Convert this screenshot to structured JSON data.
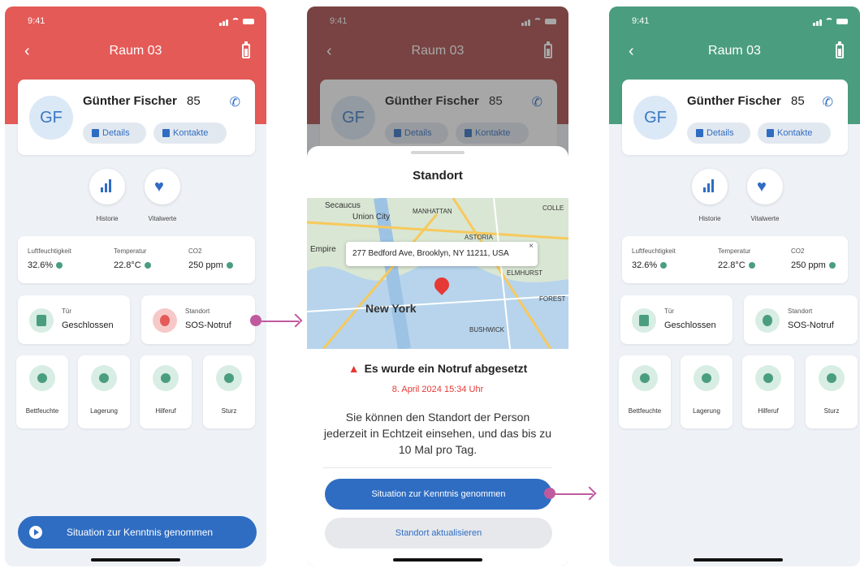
{
  "status": {
    "time": "9:41"
  },
  "header": {
    "title": "Raum 03",
    "back_icon": "chevron-left-icon",
    "battery_icon": "battery-icon"
  },
  "patient": {
    "initials": "GF",
    "name": "Günther Fischer",
    "age": "85",
    "details_label": "Details",
    "contacts_label": "Kontakte"
  },
  "round_buttons": [
    {
      "label": "Historie",
      "icon": "bar-chart-icon"
    },
    {
      "label": "Vitalwerte",
      "icon": "heart-pulse-icon"
    }
  ],
  "sensors": [
    {
      "label": "Luftfeuchtigkeit",
      "value": "32.6%"
    },
    {
      "label": "Temperatur",
      "value": "22.8°C"
    },
    {
      "label": "CO2",
      "value": "250 ppm"
    }
  ],
  "door": {
    "label": "Tür",
    "value": "Geschlossen"
  },
  "location": {
    "label": "Standort",
    "value": "SOS-Notruf"
  },
  "sensor_tiles": [
    {
      "label": "Bettfeuchte",
      "icon": "droplets-icon"
    },
    {
      "label": "Lagerung",
      "icon": "bed-icon"
    },
    {
      "label": "Hilferuf",
      "icon": "bell-icon"
    },
    {
      "label": "Sturz",
      "icon": "fall-icon"
    }
  ],
  "bottom_button": "Situation zur Kenntnis genommen",
  "sheet": {
    "title": "Standort",
    "map_labels": [
      "Secaucus",
      "Union City",
      "MANHATTAN",
      "ASTORIA",
      "Empire",
      "New York",
      "ELMHURST",
      "FOREST",
      "BUSHWICK",
      "COLLE"
    ],
    "address": "277 Bedford Ave, Brooklyn, NY 11211, USA",
    "alert": "Es wurde ein Notruf abgesetzt",
    "date": "8. April 2024  15:34 Uhr",
    "description": "Sie können den Standort der Person jederzeit in Echtzeit einsehen, und das bis zu 10 Mal pro Tag.",
    "primary_button": "Situation zur Kenntnis genommen",
    "secondary_button": "Standort aktualisieren"
  },
  "colors": {
    "alarm_red": "#e45a57",
    "ok_green": "#4a9e7f",
    "primary_blue": "#2f6dc2",
    "flow_arrow": "#c05a9f"
  }
}
